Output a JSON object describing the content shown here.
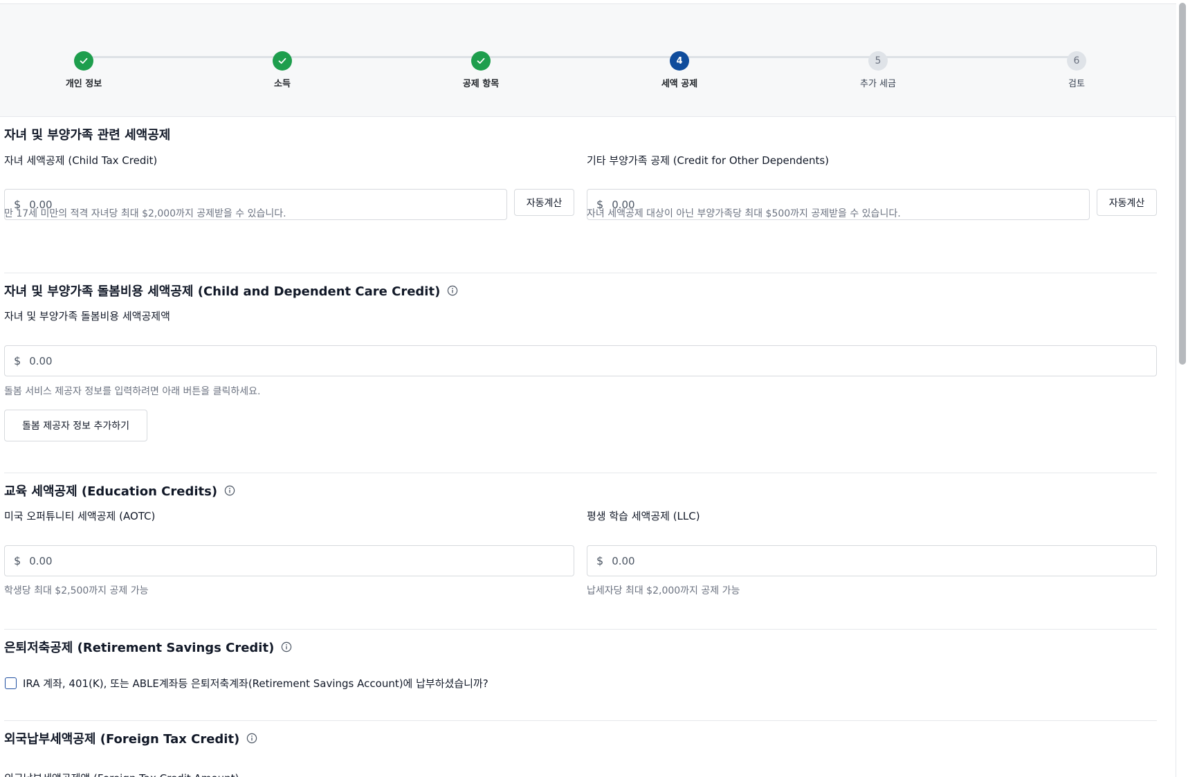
{
  "stepper": {
    "steps": [
      {
        "label": "개인 정보",
        "state": "done",
        "number": "1"
      },
      {
        "label": "소득",
        "state": "done",
        "number": "2"
      },
      {
        "label": "공제 항목",
        "state": "done",
        "number": "3"
      },
      {
        "label": "세액 공제",
        "state": "active",
        "number": "4"
      },
      {
        "label": "추가 세금",
        "state": "todo",
        "number": "5"
      },
      {
        "label": "검토",
        "state": "todo",
        "number": "6"
      }
    ]
  },
  "sections": {
    "child_dependents": {
      "title": "자녀 및 부양가족 관련 세액공제",
      "child_tax_credit": {
        "label": "자녀 세액공제 (Child Tax Credit)",
        "currency": "$",
        "placeholder": "0.00",
        "button": "자동계산",
        "help": "만 17세 미만의 적격 자녀당 최대 $2,000까지 공제받을 수 있습니다."
      },
      "other_dependents": {
        "label": "기타 부양가족 공제 (Credit for Other Dependents)",
        "currency": "$",
        "placeholder": "0.00",
        "button": "자동계산",
        "help": "자녀 세액공제 대상이 아닌 부양가족당 최대 $500까지 공제받을 수 있습니다."
      }
    },
    "care_credit": {
      "title": "자녀 및 부양가족 돌봄비용 세액공제 (Child and Dependent Care Credit)",
      "label": "자녀 및 부양가족 돌봄비용 세액공제액",
      "currency": "$",
      "placeholder": "0.00",
      "help": "돌봄 서비스 제공자 정보를 입력하려면 아래 버튼을 클릭하세요.",
      "button": "돌봄 제공자 정보 추가하기"
    },
    "education": {
      "title": "교육 세액공제 (Education Credits)",
      "aotc": {
        "label": "미국 오퍼튜니티 세액공제 (AOTC)",
        "currency": "$",
        "placeholder": "0.00",
        "help": "학생당 최대 $2,500까지 공제 가능"
      },
      "llc": {
        "label": "평생 학습 세액공제 (LLC)",
        "currency": "$",
        "placeholder": "0.00",
        "help": "납세자당 최대 $2,000까지 공제 가능"
      }
    },
    "retirement": {
      "title": "은퇴저축공제 (Retirement Savings Credit)",
      "question": "IRA 계좌, 401(K), 또는 ABLE계좌등 은퇴저축계좌(Retirement Savings Account)에 납부하셨습니까?",
      "checked": false
    },
    "foreign": {
      "title": "외국납부세액공제 (Foreign Tax Credit)",
      "label": "외국납부세액공제액 (Foreign Tax Credit Amount)"
    }
  },
  "colors": {
    "done": "#1e9e4d",
    "active": "#0f4c9c",
    "todo": "#dfe3e8",
    "checkbox_border": "#1f4fa0"
  },
  "icons": {
    "done_step": "check-icon",
    "section_info": "info-icon"
  }
}
